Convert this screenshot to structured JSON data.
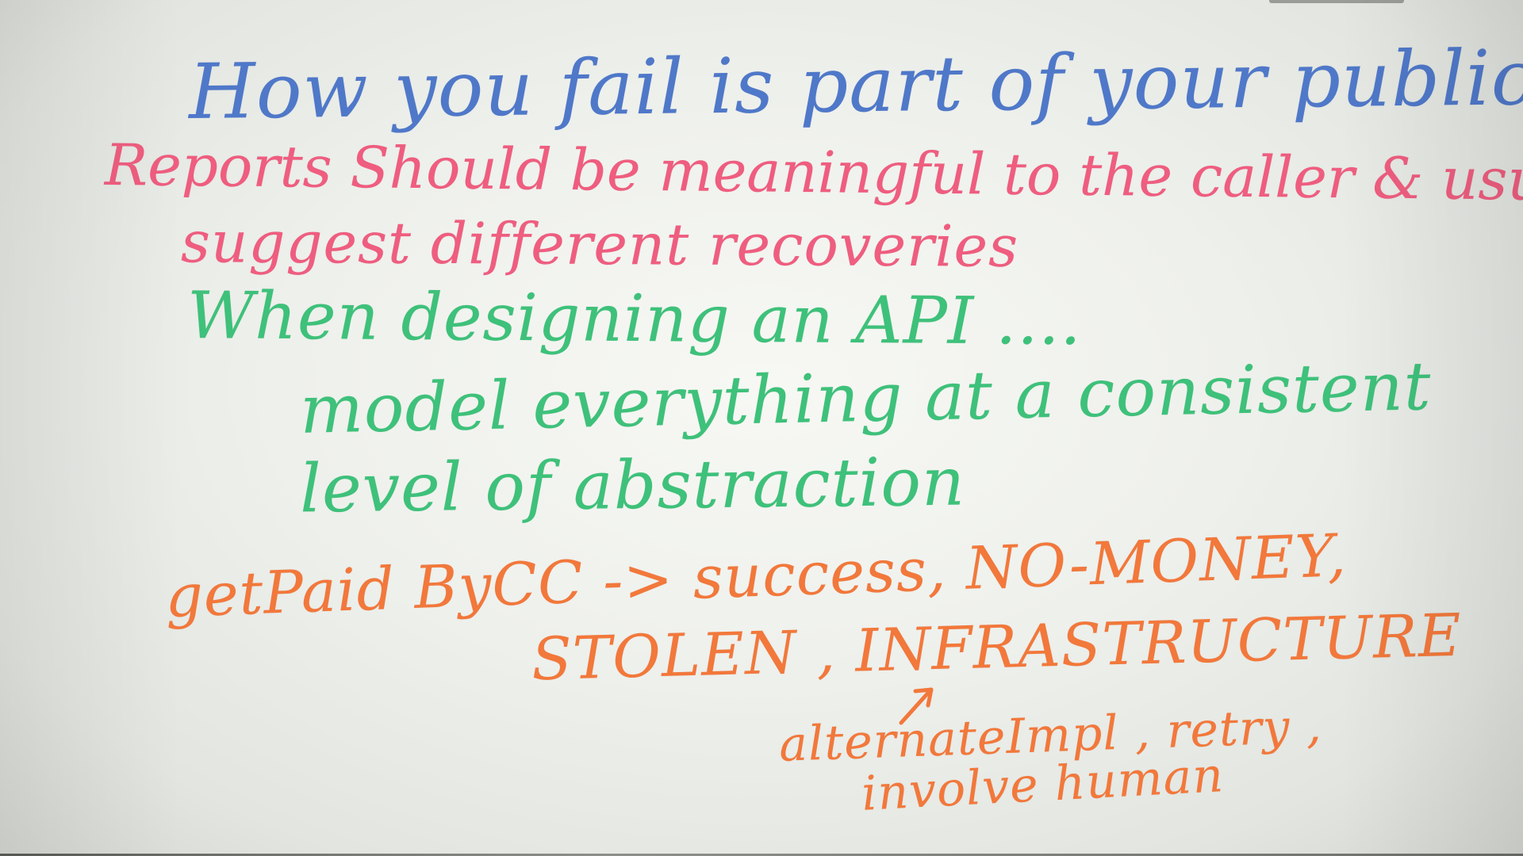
{
  "whiteboard": {
    "lines": [
      "How you fail   is part of your public API",
      "Reports Should be meaningful to the caller & usually",
      "suggest different recoveries",
      "When designing an API ....",
      "model everything at a consistent",
      "level of abstraction",
      "getPaid ByCC -> success, NO-MONEY,",
      "STOLEN , INFRASTRUCTURE",
      "alternateImpl , retry ,",
      "involve human"
    ],
    "colors": {
      "blue": "#4f78c9",
      "pink": "#ef5d7f",
      "green": "#3ec17a",
      "orange": "#f2783b"
    }
  }
}
